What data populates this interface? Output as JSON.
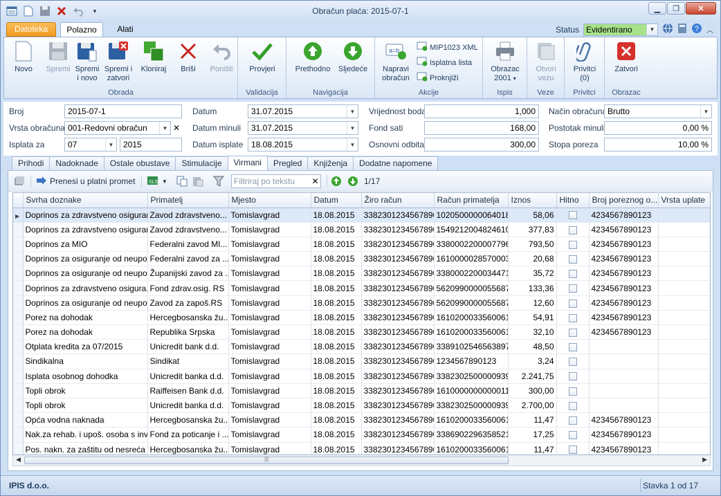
{
  "window": {
    "title": "Obračun plaća: 2015-07-1"
  },
  "tabs": {
    "file": "Datoteka",
    "home": "Polazno",
    "tools": "Alati"
  },
  "status": {
    "label": "Status",
    "value": "Evidentirano"
  },
  "ribbon": {
    "obrada": {
      "label": "Obrada",
      "novo": "Novo",
      "spremi": "Spremi",
      "spremi_novo": "Spremi i novo",
      "spremi_zatvori": "Spremi i zatvori",
      "kloniraj": "Kloniraj",
      "brisi": "Briši",
      "ponisti": "Poništi"
    },
    "validacija": {
      "label": "Validacija",
      "provjeri": "Provjeri"
    },
    "navigacija": {
      "label": "Navigacija",
      "prethodno": "Prethodno",
      "sljedece": "Sljedeće"
    },
    "akcije": {
      "label": "Akcije",
      "napravi": "Napravi obračun",
      "mip": "MIP1023 XML",
      "isplatna": "Isplatna lista",
      "proknjizi": "Proknjiži"
    },
    "ispis": {
      "label": "Ispis",
      "obrazac": "Obrazac 2001"
    },
    "veze": {
      "label": "Veze",
      "otvori": "Otvori vezu"
    },
    "privitci": {
      "label": "Privitci",
      "privitci": "Privitci (0)"
    },
    "obrazac": {
      "label": "Obrazac",
      "zatvori": "Zatvori"
    }
  },
  "form": {
    "broj": {
      "label": "Broj",
      "value": "2015-07-1"
    },
    "vrsta": {
      "label": "Vrsta obračuna",
      "value": "001-Redovni obračun"
    },
    "isplata": {
      "label": "Isplata za",
      "month": "07",
      "year": "2015"
    },
    "datum": {
      "label": "Datum",
      "value": "31.07.2015"
    },
    "datum_minuli": {
      "label": "Datum minuli",
      "value": "31.07.2015"
    },
    "datum_isplate": {
      "label": "Datum isplate",
      "value": "18.08.2015"
    },
    "vrijednost_boda": {
      "label": "Vrijednost boda",
      "value": "1,000"
    },
    "fond_sati": {
      "label": "Fond sati",
      "value": "168,00"
    },
    "osnovni_odbitak": {
      "label": "Osnovni odbitak",
      "value": "300,00"
    },
    "nacin": {
      "label": "Način obračuna",
      "value": "Brutto"
    },
    "postotak_minuli": {
      "label": "Postotak minuli",
      "value": "0,00 %"
    },
    "stopa_poreza": {
      "label": "Stopa poreza",
      "value": "10,00 %"
    }
  },
  "page_tabs": [
    "Prihodi",
    "Nadoknade",
    "Ostale obustave",
    "Stimulacije",
    "Virmani",
    "Pregled",
    "Knjiženja",
    "Dodatne napomene"
  ],
  "grid_toolbar": {
    "prenesi": "Prenesi u platni promet",
    "filter_placeholder": "Filtriraj po tekstu",
    "counter": "1/17"
  },
  "columns": [
    "Svrha doznake",
    "Primatelj",
    "Mjesto",
    "Datum",
    "Žiro račun",
    "Račun primatelja",
    "Iznos",
    "Hitno",
    "Broj poreznog o...",
    "Vrsta uplate"
  ],
  "rows": [
    [
      "Doprinos za zdravstveno osiguranje",
      "Zavod zdravstveno...",
      "Tomislavgrad",
      "18.08.2015",
      "3382301234567890",
      "1020500000064018",
      "58,06",
      "4234567890123",
      ""
    ],
    [
      "Doprinos za zdravstveno osiguranje",
      "Zavod zdravstveno...",
      "Tomislavgrad",
      "18.08.2015",
      "3382301234567890",
      "1549212004824610",
      "377,83",
      "4234567890123",
      ""
    ],
    [
      "Doprinos za MIO",
      "Federalni zavod MI...",
      "Tomislavgrad",
      "18.08.2015",
      "3382301234567890",
      "3380002200007796",
      "793,50",
      "4234567890123",
      ""
    ],
    [
      "Doprinos za osiguranje od neupos...",
      "Federalni zavod za ...",
      "Tomislavgrad",
      "18.08.2015",
      "3382301234567890",
      "1610000028570003",
      "20,68",
      "4234567890123",
      ""
    ],
    [
      "Doprinos za osiguranje od neupos...",
      "Županijski zavod za ...",
      "Tomislavgrad",
      "18.08.2015",
      "3382301234567890",
      "3380002200034471",
      "35,72",
      "4234567890123",
      ""
    ],
    [
      "Doprinos za zdravstveno osigura...",
      "Fond zdrav.osig. RS",
      "Tomislavgrad",
      "18.08.2015",
      "3382301234567890",
      "5620990000055687",
      "133,36",
      "4234567890123",
      ""
    ],
    [
      "Doprinos za osiguranje od neupos...",
      "Zavod za zapoš.RS",
      "Tomislavgrad",
      "18.08.2015",
      "3382301234567890",
      "5620990000055687",
      "12,60",
      "4234567890123",
      ""
    ],
    [
      "Porez na dohodak",
      "Hercegbosanska žu...",
      "Tomislavgrad",
      "18.08.2015",
      "3382301234567890",
      "1610200033560061",
      "54,91",
      "4234567890123",
      ""
    ],
    [
      "Porez na dohodak",
      "Republika Srpska",
      "Tomislavgrad",
      "18.08.2015",
      "3382301234567890",
      "1610200033560061",
      "32,10",
      "4234567890123",
      ""
    ],
    [
      "Otplata kredita za 07/2015",
      "Unicredit bank d.d.",
      "Tomislavgrad",
      "18.08.2015",
      "3382301234567890",
      "3389102546563897",
      "48,50",
      "",
      ""
    ],
    [
      "Sindikalna",
      "Sindikat",
      "Tomislavgrad",
      "18.08.2015",
      "3382301234567890",
      "1234567890123",
      "3,24",
      "",
      ""
    ],
    [
      "Isplata osobnog dohodka",
      "Unicredit banka d.d.",
      "Tomislavgrad",
      "18.08.2015",
      "3382301234567890",
      "3382302500000939",
      "2.241,75",
      "",
      ""
    ],
    [
      "Topli obrok",
      "Raiffeisen Bank d.d.",
      "Tomislavgrad",
      "18.08.2015",
      "3382301234567890",
      "1610000000000011",
      "300,00",
      "",
      ""
    ],
    [
      "Topli obrok",
      "Unicredit banka d.d.",
      "Tomislavgrad",
      "18.08.2015",
      "3382301234567890",
      "3382302500000939",
      "2.700,00",
      "",
      ""
    ],
    [
      "Opća vodna naknada",
      "Hercegbosanska žu...",
      "Tomislavgrad",
      "18.08.2015",
      "3382301234567890",
      "1610200033560061",
      "11,47",
      "4234567890123",
      ""
    ],
    [
      "Nak.za rehab. i upoš. osoba s inv.",
      "Fond za poticanje i ...",
      "Tomislavgrad",
      "18.08.2015",
      "3382301234567890",
      "3386902296358521",
      "17,25",
      "4234567890123",
      ""
    ],
    [
      "Pos. nakn. za zaštitu od nesreća",
      "Hercegbosanska žu...",
      "Tomislavgrad",
      "18.08.2015",
      "3382301234567890",
      "1610200033560061",
      "11,47",
      "4234567890123",
      ""
    ]
  ],
  "statusbar": {
    "company": "IPIS d.o.o.",
    "record": "Stavka 1 od 17"
  }
}
